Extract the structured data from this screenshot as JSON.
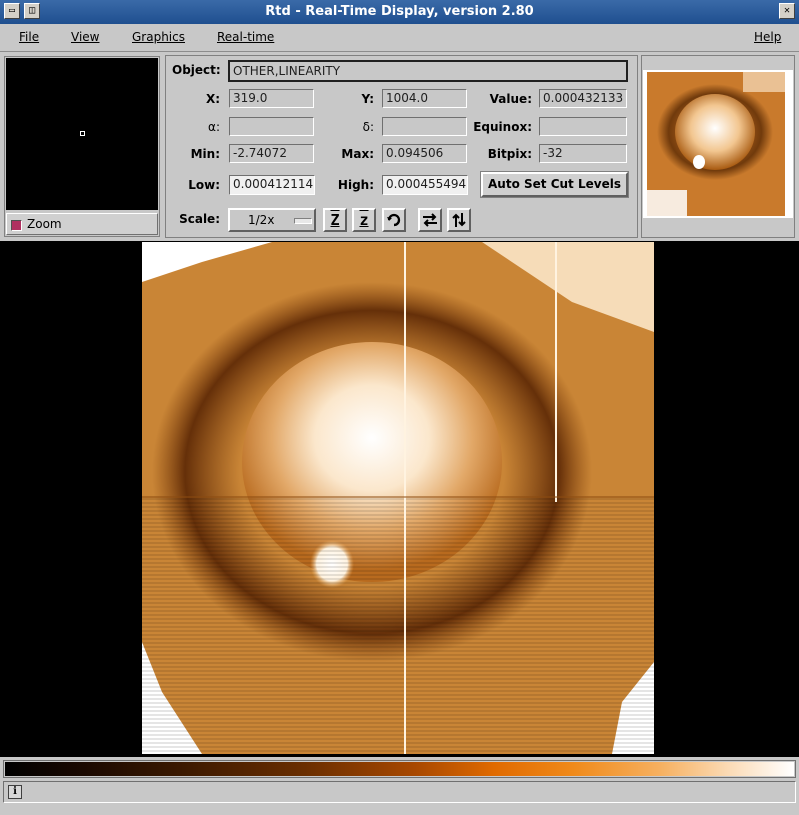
{
  "window": {
    "title": "Rtd - Real-Time Display, version 2.80",
    "menu_icon": "window-menu-icon",
    "maximize_icon": "maximize-icon",
    "close_icon": "close-icon"
  },
  "menubar": {
    "file": "File",
    "view": "View",
    "graphics": "Graphics",
    "realtime": "Real-time",
    "help": "Help"
  },
  "zoom": {
    "label": "Zoom",
    "checked": true
  },
  "info": {
    "object_label": "Object:",
    "object_value": "OTHER,LINEARITY",
    "x_label": "X:",
    "x_value": "319.0",
    "y_label": "Y:",
    "y_value": "1004.0",
    "value_label": "Value:",
    "value_value": "0.000432133",
    "alpha_label": "α:",
    "alpha_value": "",
    "delta_label": "δ:",
    "delta_value": "",
    "equinox_label": "Equinox:",
    "equinox_value": "",
    "min_label": "Min:",
    "min_value": "-2.74072",
    "max_label": "Max:",
    "max_value": "0.094506",
    "bitpix_label": "Bitpix:",
    "bitpix_value": "-32",
    "low_label": "Low:",
    "low_value": "0.000412114",
    "high_label": "High:",
    "high_value": "0.000455494",
    "autoset_label": "Auto Set Cut Levels",
    "scale_label": "Scale:",
    "scale_value": "1/2x"
  },
  "tools": {
    "zoom_in": "Z",
    "zoom_out": "z",
    "rotate_icon": "rotate-icon",
    "flip_x_icon": "flip-x-icon",
    "flip_y_icon": "flip-y-icon"
  },
  "colors": {
    "accent_orange": "#e06a00",
    "title_bar": "#1f4f8f",
    "panel_gray": "#c8c8c8"
  },
  "status": {
    "text": ""
  }
}
